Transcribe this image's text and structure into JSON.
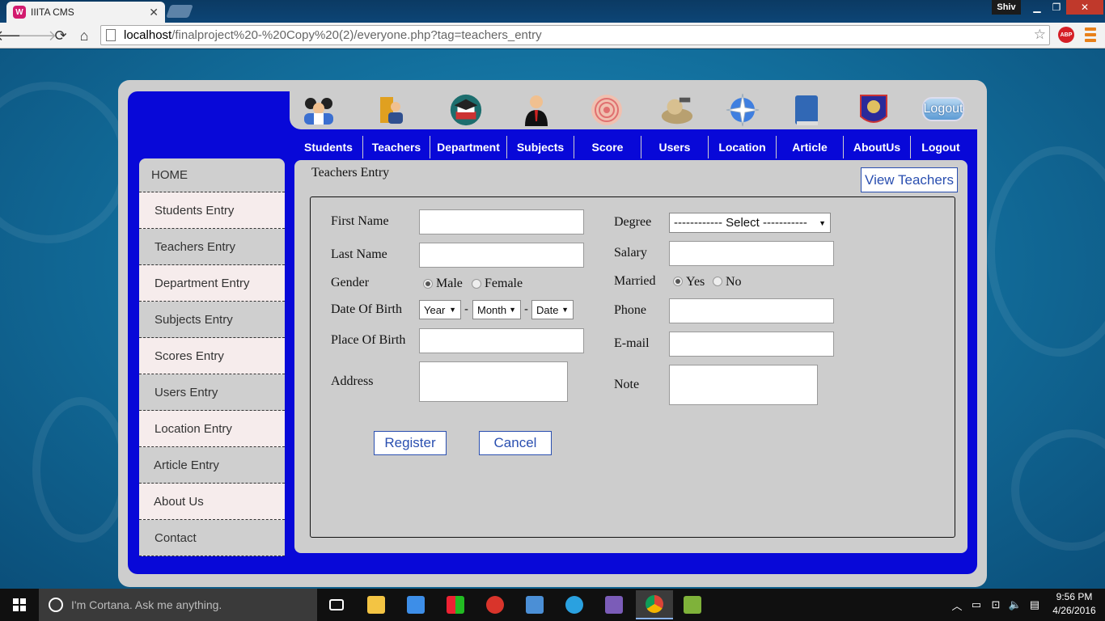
{
  "browser": {
    "tab_title": "IIITA CMS",
    "tab_icon_letter": "W",
    "url_host": "localhost",
    "url_path": "/finalproject%20-%20Copy%20(2)/everyone.php?tag=teachers_entry",
    "user": "Shiv",
    "abp_label": "ABP"
  },
  "header": {
    "icons": [
      "students-icon",
      "teachers-icon",
      "department-icon",
      "subjects-icon",
      "score-icon",
      "users-icon",
      "location-icon",
      "article-icon",
      "aboutus-icon"
    ],
    "logout_button": "Logout"
  },
  "navbar": [
    "Students",
    "Teachers",
    "Department",
    "Subjects",
    "Score",
    "Users",
    "Location",
    "Article",
    "AboutUs",
    "Logout"
  ],
  "sidebar": [
    "HOME",
    "Students Entry",
    "Teachers Entry",
    "Department Entry",
    "Subjects Entry",
    "Scores Entry",
    "Users Entry",
    "Location Entry",
    "Article Entry",
    "About Us",
    "Contact"
  ],
  "content": {
    "title": "Teachers Entry",
    "view_button": "View Teachers"
  },
  "form": {
    "first_name": "First Name",
    "last_name": "Last Name",
    "gender": "Gender",
    "gender_male": "Male",
    "gender_female": "Female",
    "gender_selected": "Male",
    "dob": "Date Of Birth",
    "dob_year": "Year",
    "dob_month": "Month",
    "dob_date": "Date",
    "dob_sep": "-",
    "place_of_birth": "Place Of Birth",
    "address": "Address",
    "degree": "Degree",
    "degree_select": "------------ Select -----------",
    "salary": "Salary",
    "married": "Married",
    "married_yes": "Yes",
    "married_no": "No",
    "married_selected": "Yes",
    "phone": "Phone",
    "email": "E-mail",
    "note": "Note",
    "register_button": "Register",
    "cancel_button": "Cancel"
  },
  "taskbar": {
    "search_placeholder": "I'm Cortana. Ask me anything.",
    "time": "9:56 PM",
    "date": "4/26/2016"
  }
}
